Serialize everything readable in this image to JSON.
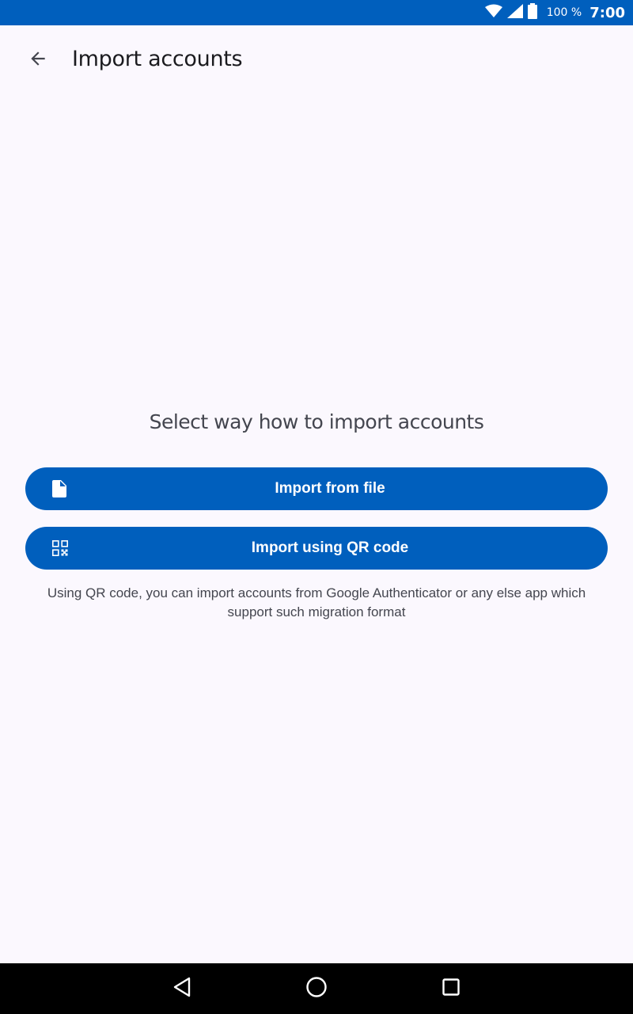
{
  "status_bar": {
    "battery_percent": "100 %",
    "clock": "7:00",
    "background_color": "#005fbd"
  },
  "app_bar": {
    "title": "Import accounts",
    "back_icon": "arrow-back-icon"
  },
  "main": {
    "prompt": "Select way how to import accounts",
    "buttons": [
      {
        "label": "Import from file",
        "icon": "file-icon"
      },
      {
        "label": "Import using QR code",
        "icon": "qr-code-icon"
      }
    ],
    "hint": "Using QR code, you can import accounts from Google Authenticator or any else app which support such migration format"
  },
  "colors": {
    "primary": "#005fbd",
    "background": "#fbf8fe",
    "text_primary": "#1b1b1f",
    "text_secondary": "#44464f"
  },
  "nav_bar": {
    "icons": [
      "back-triangle-icon",
      "home-circle-icon",
      "recents-square-icon"
    ]
  }
}
